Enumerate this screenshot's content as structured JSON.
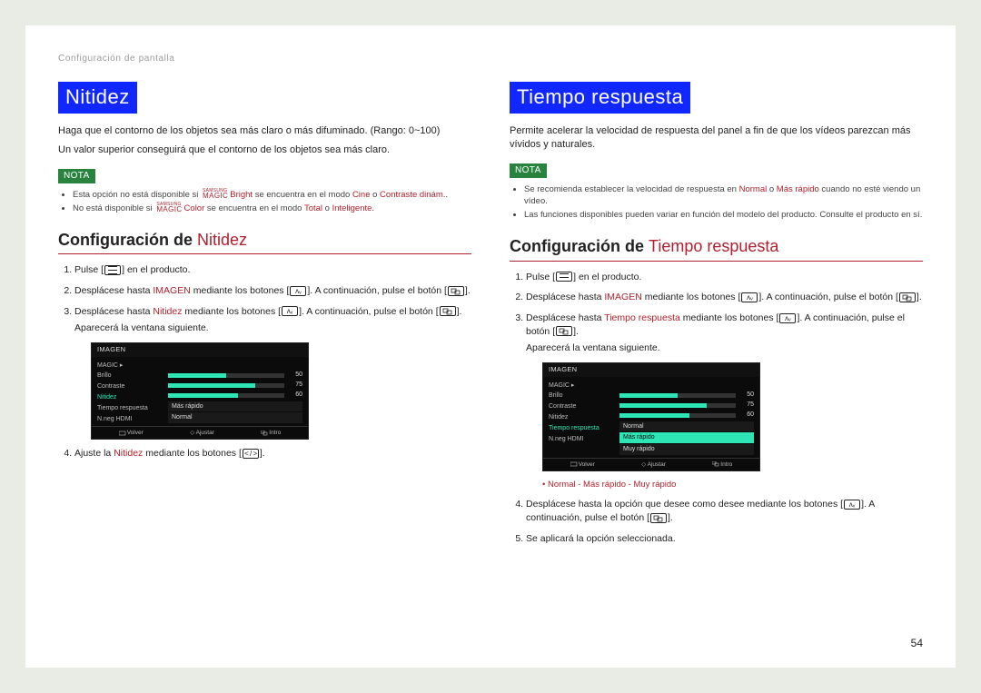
{
  "breadcrumb": "Configuración de pantalla",
  "page_number": "54",
  "brand": {
    "top": "SAMSUNG",
    "bot": "MAGIC"
  },
  "left": {
    "title": "Nitidez",
    "p1": "Haga que el contorno de los objetos sea más claro o más difuminado. (Rango: 0~100)",
    "p2": "Un valor superior conseguirá que el contorno de los objetos sea más claro.",
    "nota": "NOTA",
    "b1a": "Esta opción no está disponible si ",
    "b1_app": "Bright",
    "b1b": " se encuentra en el modo ",
    "b1_m1": "Cine",
    "b1_o": " o ",
    "b1_m2": "Contraste dinám.",
    "b2a": "No está disponible si ",
    "b2_app": "Color",
    "b2b": " se encuentra en el modo ",
    "b2_m1": "Total",
    "b2_o": " o ",
    "b2_m2": "Inteligente",
    "sub_pre": "Configuración de ",
    "sub_acc": "Nitidez",
    "s1a": "Pulse [",
    "s1b": "] en el producto.",
    "s2a": "Desplácese hasta ",
    "s2_target": "IMAGEN",
    "s2b": " mediante los botones [",
    "s2c": "]. A continuación, pulse el botón [",
    "s2d": "].",
    "s3a": "Desplácese hasta ",
    "s3_target": "Nitidez",
    "s3b": " mediante los botones [",
    "s3c": "]. A continuación, pulse el botón [",
    "s3d": "].",
    "s3e": "Aparecerá la ventana siguiente.",
    "s4a": "Ajuste la ",
    "s4_target": "Nitidez",
    "s4b": " mediante los botones [",
    "s4c": "]."
  },
  "right": {
    "title": "Tiempo respuesta",
    "p1": "Permite acelerar la velocidad de respuesta del panel a fin de que los vídeos parezcan más vívidos y naturales.",
    "nota": "NOTA",
    "b1a": "Se recomienda establecer la velocidad de respuesta en ",
    "b1_m1": "Normal",
    "b1_o": " o ",
    "b1_m2": "Más rápido",
    "b1b": " cuando no esté viendo un vídeo.",
    "b2": "Las funciones disponibles pueden variar en función del modelo del producto. Consulte el producto en sí.",
    "sub_pre": "Configuración de ",
    "sub_acc": "Tiempo respuesta",
    "s1a": "Pulse [",
    "s1b": "] en el producto.",
    "s2a": "Desplácese hasta ",
    "s2_target": "IMAGEN",
    "s2b": " mediante los botones [",
    "s2c": "]. A continuación, pulse el botón [",
    "s2d": "].",
    "s3a": "Desplácese hasta ",
    "s3_target": "Tiempo respuesta",
    "s3b": " mediante los botones [",
    "s3c": "]. A continuación, pulse el botón [",
    "s3d": "].",
    "s3e": "Aparecerá la ventana siguiente.",
    "opts": "Normal - Más rápido - Muy rápido",
    "s4a": "Desplácese hasta la opción que desee como desee mediante los botones [",
    "s4b": "]. A continuación, pulse el botón [",
    "s4c": "].",
    "s5": "Se aplicará la opción seleccionada."
  },
  "osd": {
    "title": "IMAGEN",
    "row_magic": "MAGIC",
    "row_brillo": "Brillo",
    "row_contraste": "Contraste",
    "row_nitidez": "Nitidez",
    "row_tiempo": "Tiempo respuesta",
    "row_hdmi": "N.neg HDMI",
    "val50": "50",
    "val75": "75",
    "val60": "60",
    "opt_masrapido": "Más rápido",
    "opt_normal": "Normal",
    "opt_muyrapido": "Muy rápido",
    "foot_volver": "Volver",
    "foot_ajustar": "Ajustar",
    "foot_intro": "Intro",
    "chev": "▸"
  }
}
